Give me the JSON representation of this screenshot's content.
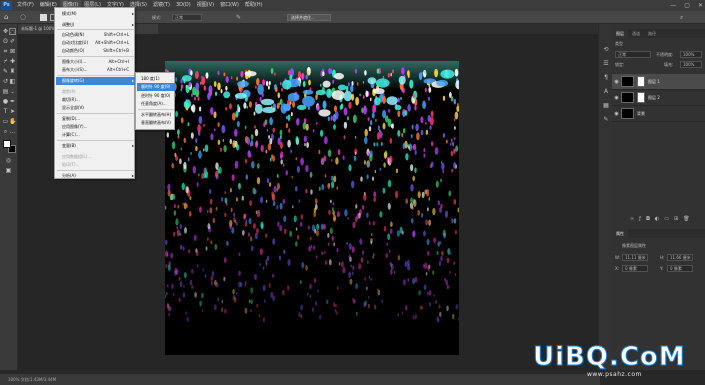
{
  "app": {
    "logo": "Ps"
  },
  "menubar": {
    "items": [
      "文件(F)",
      "编辑(E)",
      "图像(I)",
      "图层(L)",
      "文字(Y)",
      "选择(S)",
      "滤镜(T)",
      "3D(D)",
      "视图(V)",
      "窗口(W)",
      "帮助(H)"
    ]
  },
  "window_controls": {
    "minimize": "—",
    "maximize": "▢",
    "close": "✕"
  },
  "options": {
    "mode_value": "正常",
    "mode_label": "模式:",
    "select_mask": "选择并遮住..."
  },
  "doc_tab": {
    "title": "未标题-1 @ 100% (图层 1, RGB/8)"
  },
  "status": {
    "text": "100%    文档:1.43M/3.44M"
  },
  "image_menu": {
    "items": [
      {
        "label": "模式(M)",
        "shortcut": "",
        "arrow": true,
        "disabled": false
      },
      {
        "label": "调整(J)",
        "shortcut": "",
        "arrow": true,
        "disabled": false
      },
      {
        "label": "自动色调(N)",
        "shortcut": "Shift+Ctrl+L",
        "arrow": false,
        "disabled": false
      },
      {
        "label": "自动对比度(U)",
        "shortcut": "Alt+Shift+Ctrl+L",
        "arrow": false,
        "disabled": false
      },
      {
        "label": "自动颜色(O)",
        "shortcut": "Shift+Ctrl+B",
        "arrow": false,
        "disabled": false
      },
      {
        "label": "图像大小(I)...",
        "shortcut": "Alt+Ctrl+I",
        "arrow": false,
        "disabled": false
      },
      {
        "label": "画布大小(S)...",
        "shortcut": "Alt+Ctrl+C",
        "arrow": false,
        "disabled": false
      },
      {
        "label": "图像旋转(G)",
        "shortcut": "",
        "arrow": true,
        "disabled": false,
        "highlight": true
      },
      {
        "label": "裁剪(P)",
        "shortcut": "",
        "arrow": false,
        "disabled": true
      },
      {
        "label": "裁切(R)...",
        "shortcut": "",
        "arrow": false,
        "disabled": false
      },
      {
        "label": "显示全部(V)",
        "shortcut": "",
        "arrow": false,
        "disabled": false
      },
      {
        "label": "复制(D)...",
        "shortcut": "",
        "arrow": false,
        "disabled": false
      },
      {
        "label": "应用图像(Y)...",
        "shortcut": "",
        "arrow": false,
        "disabled": false
      },
      {
        "label": "计算(C)...",
        "shortcut": "",
        "arrow": false,
        "disabled": false
      },
      {
        "label": "变量(B)",
        "shortcut": "",
        "arrow": true,
        "disabled": false
      },
      {
        "label": "应用数据组(L)...",
        "shortcut": "",
        "arrow": false,
        "disabled": true
      },
      {
        "label": "陷印(T)...",
        "shortcut": "",
        "arrow": false,
        "disabled": true
      },
      {
        "label": "分析(A)",
        "shortcut": "",
        "arrow": true,
        "disabled": false
      }
    ]
  },
  "rotate_submenu": {
    "items": [
      {
        "label": "180 度(1)",
        "highlight": false
      },
      {
        "label": "顺时针 90 度(9)",
        "highlight": true
      },
      {
        "label": "逆时针 90 度(0)",
        "highlight": false
      },
      {
        "label": "任意角度(A)...",
        "highlight": false
      },
      {
        "label": "水平翻转画布(H)",
        "highlight": false
      },
      {
        "label": "垂直翻转画布(V)",
        "highlight": false
      }
    ]
  },
  "layers_panel": {
    "tabs": [
      "图层",
      "通道",
      "路径"
    ],
    "blend_mode": "正常",
    "opacity_label": "不透明度:",
    "opacity_value": "100%",
    "fill_label": "填充:",
    "fill_value": "100%",
    "lock_label": "锁定:",
    "kind_label": "类型",
    "layers": [
      {
        "name": "图层 1",
        "selected": true,
        "thumb": "dark"
      },
      {
        "name": "图层 2",
        "selected": false,
        "thumb": "dark"
      },
      {
        "name": "背景",
        "selected": false,
        "thumb": "dark"
      }
    ]
  },
  "properties_panel": {
    "tab": "属性",
    "title": "像素图层属性",
    "w_label": "W:",
    "w_value": "11.11 厘米",
    "h_label": "H:",
    "h_value": "11.66 厘米",
    "x_label": "X:",
    "x_value": "0 像素",
    "y_label": "Y:",
    "y_value": "0 像素"
  },
  "watermark": {
    "logo": "UiBQ.CoM",
    "url": "www.psahz.com"
  },
  "colors": {
    "menu_highlight": "#3d86d6",
    "app_bg": "#282828",
    "canvas": "#000000"
  }
}
